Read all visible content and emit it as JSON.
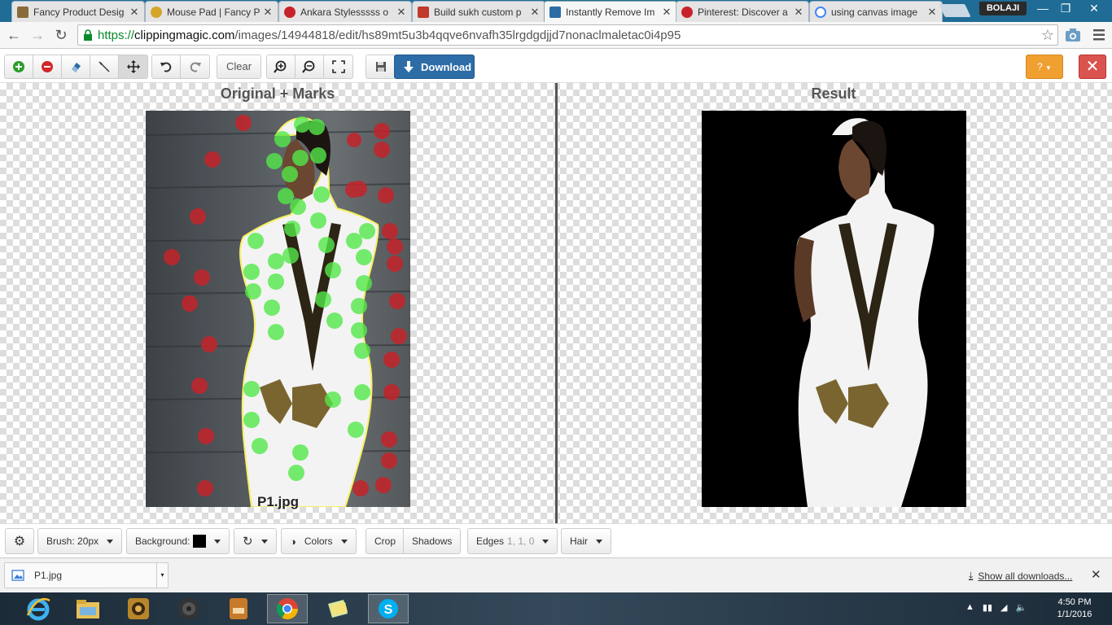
{
  "browser": {
    "tabs": [
      {
        "title": "Fancy Product Desig",
        "favicon_color": "#8a6a3a"
      },
      {
        "title": "Mouse Pad | Fancy P",
        "favicon_color": "#d4a52a"
      },
      {
        "title": "Ankara Stylesssss o",
        "favicon_color": "#c8232c"
      },
      {
        "title": "Build sukh custom p",
        "favicon_color": "#c0392b"
      },
      {
        "title": "Instantly Remove Im",
        "favicon_color": "#2d6ca6"
      },
      {
        "title": "Pinterest: Discover a",
        "favicon_color": "#c8232c"
      },
      {
        "title": "using canvas image",
        "favicon_color": "#4285f4"
      }
    ],
    "profile_name": "BOLAJI",
    "url_scheme": "https://",
    "url_host": "clippingmagic.com",
    "url_path": "/images/14944818/edit/hs89mt5u3b4qqve6nvafh35lrgdgdjjd7nonaclmaletac0i4p95"
  },
  "toolbar": {
    "clear_label": "Clear",
    "download_label": "Download",
    "help_label": "?"
  },
  "workspace": {
    "left_title": "Original + Marks",
    "right_title": "Result",
    "filename": "P1.jpg"
  },
  "bottom": {
    "brush_label": "Brush: 20px",
    "background_label": "Background:",
    "colors_label": "Colors",
    "crop_label": "Crop",
    "shadows_label": "Shadows",
    "edges_label": "Edges",
    "edges_values": "1, 1, 0",
    "hair_label": "Hair"
  },
  "shelf": {
    "download_name": "P1.jpg",
    "show_all_label": "Show all downloads..."
  },
  "taskbar": {
    "time": "4:50 PM",
    "date": "1/1/2016"
  }
}
